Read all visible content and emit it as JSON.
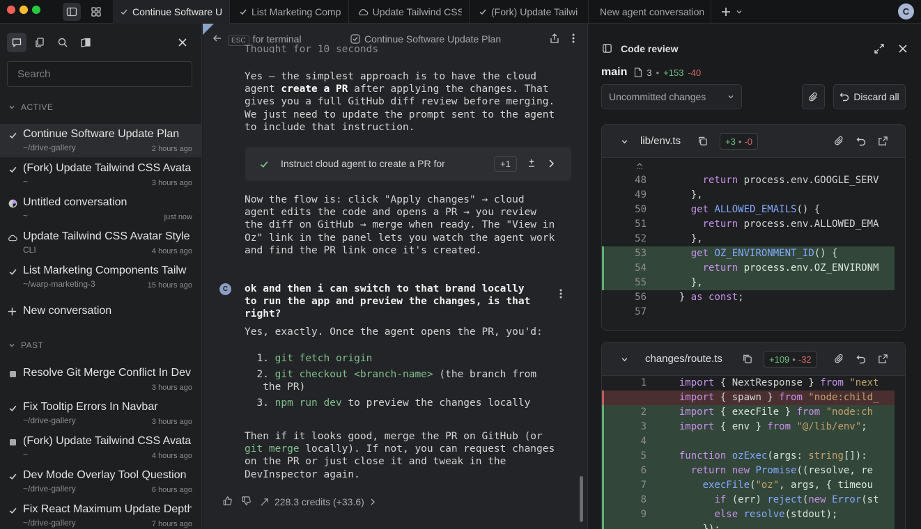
{
  "tabs": [
    {
      "label": "Continue Software U",
      "icon": "check"
    },
    {
      "label": "List Marketing Comp",
      "icon": "check"
    },
    {
      "label": "Update Tailwind CSS",
      "icon": "cloud"
    },
    {
      "label": "(Fork) Update Tailwi",
      "icon": "check"
    },
    {
      "label": "New agent conversation",
      "icon": ""
    }
  ],
  "user_initial": "C",
  "sidebar": {
    "search_placeholder": "Search",
    "active_label": "ACTIVE",
    "past_label": "PAST",
    "new_conversation": "New conversation",
    "active": [
      {
        "title": "Continue Software Update Plan",
        "sub": "~/drive-gallery",
        "time": "2 hours ago",
        "icon": "check"
      },
      {
        "title": "(Fork) Update Tailwind CSS Avatar",
        "sub": "~",
        "time": "3 hours ago",
        "icon": "check"
      },
      {
        "title": "Untitled conversation",
        "sub": "~",
        "time": "just now",
        "icon": "half"
      },
      {
        "title": "Update Tailwind CSS Avatar Style",
        "sub": "CLI",
        "time": "4 hours ago",
        "icon": "cloud"
      },
      {
        "title": "List Marketing Components Tailw",
        "sub": "~/warp-marketing-3",
        "time": "15 hours ago",
        "icon": "check"
      }
    ],
    "past": [
      {
        "title": "Resolve Git Merge Conflict In Dev",
        "sub": "",
        "time": "3 hours ago",
        "icon": "square"
      },
      {
        "title": "Fix Tooltip Errors In Navbar",
        "sub": "~/drive-gallery",
        "time": "3 hours ago",
        "icon": "check"
      },
      {
        "title": "(Fork) Update Tailwind CSS Avata",
        "sub": "~",
        "time": "4 hours ago",
        "icon": "square"
      },
      {
        "title": "Dev Mode Overlay Tool Question",
        "sub": "~/drive-gallery",
        "time": "6 hours ago",
        "icon": "check"
      },
      {
        "title": "Fix React Maximum Update Depth",
        "sub": "~/drive-gallery",
        "time": "7 hours ago",
        "icon": "check"
      }
    ]
  },
  "chat": {
    "esc_key": "ESC",
    "esc_label": "for terminal",
    "title": "Continue Software Update Plan",
    "thought": "Thought for 10 seconds",
    "para1": "Yes — the simplest approach is to have the cloud\nagent |create a PR| after applying the changes. That\ngives you a full GitHub diff review before merging.\nWe just need to update the prompt sent to the agent\nto include that instruction.",
    "para1_pre": "Yes — the simplest approach is to have the cloud\nagent ",
    "para1_bold": "create a PR",
    "para1_post": " after applying the changes. That\ngives you a full GitHub diff review before merging.\nWe just need to update the prompt sent to the agent\nto include that instruction.",
    "todo_label": "Instruct cloud agent to create a PR for rev",
    "todo_count": "+1",
    "para2": "Now the flow is: click \"Apply changes\" → cloud\nagent edits the code and opens a PR → you review\nthe diff on GitHub → merge when ready. The \"View in\nOz\" link in the panel lets you watch the agent work\nand find the PR link once it's created.",
    "user_avatar": "C",
    "user_msg": "ok and then i can switch to that brand locally\nto run the app and preview the changes, is that\nright?",
    "reply_intro": "Yes, exactly. Once the agent opens the PR, you'd:",
    "steps": [
      {
        "num": "1.",
        "cmd": "git fetch origin",
        "rest": ""
      },
      {
        "num": "2.",
        "cmd": "git checkout <branch-name>",
        "rest": " (the branch from\n   the PR)"
      },
      {
        "num": "3.",
        "cmd": "npm run dev",
        "rest": " to preview the changes locally"
      }
    ],
    "closing_pre": "Then if it looks good, merge the PR on GitHub (or\n",
    "closing_cmd": "git merge",
    "closing_post": " locally). If not, you can request changes\non the PR or just close it and tweak in the\nDevInspector again.",
    "credits": "228.3 credits (+33.6)"
  },
  "review": {
    "title": "Code review",
    "branch": "main",
    "files_count": "3",
    "additions": "+153",
    "deletions": "-40",
    "dropdown": "Uncommitted changes",
    "discard": "Discard all",
    "files": [
      {
        "name": "lib/env.ts",
        "add": "+3",
        "del": "-0",
        "lines": [
          {
            "no": "48",
            "code": "      return process.env.GOOGLE_SERV",
            "type": "ctx"
          },
          {
            "no": "49",
            "code": "    },",
            "type": "ctx"
          },
          {
            "no": "50",
            "code": "    get ALLOWED_EMAILS() {",
            "type": "ctx"
          },
          {
            "no": "51",
            "code": "      return process.env.ALLOWED_EMA",
            "type": "ctx"
          },
          {
            "no": "52",
            "code": "    },",
            "type": "ctx"
          },
          {
            "no": "53",
            "code": "    get OZ_ENVIRONMENT_ID() {",
            "type": "add"
          },
          {
            "no": "54",
            "code": "      return process.env.OZ_ENVIRONM",
            "type": "add"
          },
          {
            "no": "55",
            "code": "    },",
            "type": "add"
          },
          {
            "no": "56",
            "code": "  } as const;",
            "type": "ctx"
          },
          {
            "no": "57",
            "code": "",
            "type": "ctx"
          }
        ]
      },
      {
        "name": "changes/route.ts",
        "add": "+109",
        "del": "-32",
        "lines": [
          {
            "no": "1",
            "code": "  import { NextResponse } from \"next",
            "type": "ctx"
          },
          {
            "no": "",
            "code": "  import { spawn } from \"node:child_",
            "type": "del"
          },
          {
            "no": "2",
            "code": "  import { execFile } from \"node:ch",
            "type": "add"
          },
          {
            "no": "3",
            "code": "  import { env } from \"@/lib/env\";",
            "type": "add"
          },
          {
            "no": "4",
            "code": "",
            "type": "add"
          },
          {
            "no": "5",
            "code": "  function ozExec(args: string[]): ",
            "type": "add"
          },
          {
            "no": "6",
            "code": "    return new Promise((resolve, re",
            "type": "add"
          },
          {
            "no": "7",
            "code": "      execFile(\"oz\", args, { timeou",
            "type": "add"
          },
          {
            "no": "8",
            "code": "        if (err) reject(new Error(st",
            "type": "add"
          },
          {
            "no": "9",
            "code": "        else resolve(stdout);",
            "type": "add"
          },
          {
            "no": "",
            "code": "      });",
            "type": "add"
          }
        ]
      }
    ]
  },
  "colors": {
    "accent_green": "#5fb072",
    "accent_red": "#c15d5d",
    "cmd_green": "#7fbf8a"
  }
}
